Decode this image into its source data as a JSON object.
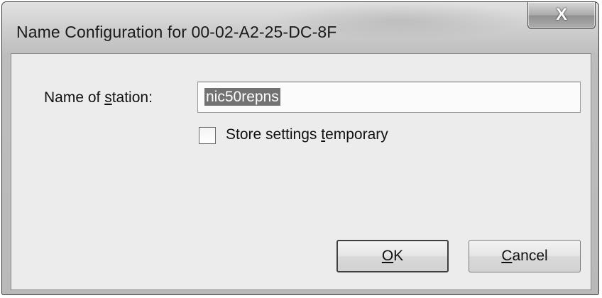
{
  "window": {
    "title": "Name Configuration for 00-02-A2-25-DC-8F",
    "close_icon": "close-icon",
    "close_glyph": "X"
  },
  "form": {
    "station_label_pre": "Name of ",
    "station_label_mnemonic": "s",
    "station_label_post": "tation:",
    "station_value": "nic50repns",
    "store_label_pre": "Store settings ",
    "store_label_mnemonic": "t",
    "store_label_post": "emporary",
    "store_checked": false
  },
  "buttons": {
    "ok_mnemonic": "O",
    "ok_post": "K",
    "cancel_mnemonic": "C",
    "cancel_post": "ancel"
  }
}
